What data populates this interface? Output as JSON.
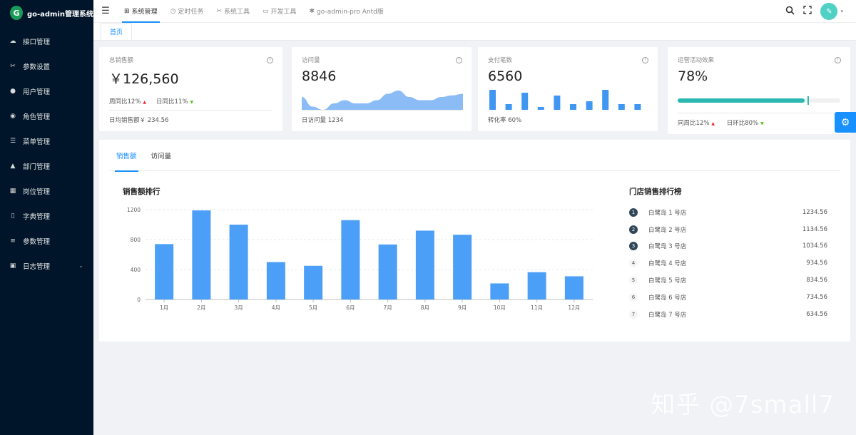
{
  "app": {
    "title": "go-admin管理系统",
    "logo_letter": "G"
  },
  "sidebar": {
    "items": [
      {
        "label": "接口管理",
        "icon": "cloud-icon"
      },
      {
        "label": "参数设置",
        "icon": "tools-icon"
      },
      {
        "label": "用户管理",
        "icon": "user-icon"
      },
      {
        "label": "角色管理",
        "icon": "team-icon"
      },
      {
        "label": "菜单管理",
        "icon": "menu-tree-icon"
      },
      {
        "label": "部门管理",
        "icon": "org-icon"
      },
      {
        "label": "岗位管理",
        "icon": "post-icon"
      },
      {
        "label": "字典管理",
        "icon": "book-icon"
      },
      {
        "label": "参数管理",
        "icon": "sliders-icon"
      },
      {
        "label": "日志管理",
        "icon": "log-icon",
        "expandable": true
      }
    ]
  },
  "topnav": {
    "items": [
      {
        "label": "系统管理",
        "active": true
      },
      {
        "label": "定时任务"
      },
      {
        "label": "系统工具"
      },
      {
        "label": "开发工具"
      },
      {
        "label": "go-admin-pro Antd版"
      }
    ]
  },
  "tabs": {
    "home": "首页"
  },
  "cards": {
    "sales": {
      "title": "总销售额",
      "value": "￥126,560",
      "wow": "周同比12%",
      "dod": "日同比11%",
      "footer": "日均销售额￥ 234.56"
    },
    "visits": {
      "title": "访问量",
      "value": "8846",
      "footer": "日访问量 1234"
    },
    "payments": {
      "title": "支付笔数",
      "value": "6560",
      "footer": "转化率 60%"
    },
    "campaign": {
      "title": "运营活动效果",
      "value": "78%",
      "progress": 0.78,
      "target": 0.8,
      "wow": "同周比12%",
      "dod": "日环比80%"
    }
  },
  "mini_charts": {
    "visits_area": [
      4,
      1,
      0,
      2,
      3,
      2,
      2,
      3,
      5,
      6,
      4,
      3,
      3,
      4,
      4.5,
      5
    ],
    "payments_bars": [
      7,
      2,
      6,
      1,
      5,
      2,
      3,
      7,
      2,
      2
    ]
  },
  "panel": {
    "tabs": [
      "销售额",
      "访问量"
    ],
    "active_tab": 0,
    "chart_title": "销售额排行",
    "rank_title": "门店销售排行榜",
    "rank": [
      {
        "no": "1",
        "name": "白鹭岛 1 号店",
        "value": "1234.56"
      },
      {
        "no": "2",
        "name": "白鹭岛 2 号店",
        "value": "1134.56"
      },
      {
        "no": "3",
        "name": "白鹭岛 3 号店",
        "value": "1034.56"
      },
      {
        "no": "4",
        "name": "白鹭岛 4 号店",
        "value": "934.56"
      },
      {
        "no": "5",
        "name": "白鹭岛 5 号店",
        "value": "834.56"
      },
      {
        "no": "6",
        "name": "白鹭岛 6 号店",
        "value": "734.56"
      },
      {
        "no": "7",
        "name": "白鹭岛 7 号店",
        "value": "634.56"
      }
    ]
  },
  "chart_data": {
    "type": "bar",
    "categories": [
      "1月",
      "2月",
      "3月",
      "4月",
      "5月",
      "6月",
      "7月",
      "8月",
      "9月",
      "10月",
      "11月",
      "12月"
    ],
    "values": [
      740,
      1190,
      1000,
      500,
      450,
      1060,
      735,
      920,
      865,
      215,
      365,
      310
    ],
    "ylim": [
      0,
      1200
    ],
    "yticks": [
      0,
      400,
      800,
      1200
    ],
    "grid": true,
    "color": "#4c9ff7"
  },
  "colors": {
    "accent": "#1890ff",
    "sidebar_bg": "#001529",
    "progress": "#2ab8b0",
    "bar": "#4c9ff7"
  },
  "watermark": "知乎 @7small7"
}
